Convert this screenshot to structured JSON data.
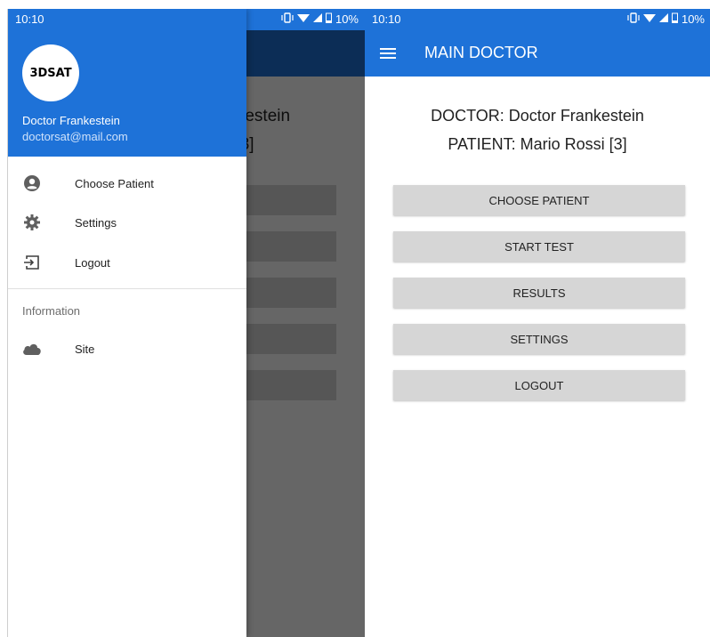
{
  "status_bar": {
    "time": "10:10",
    "battery": "10%"
  },
  "drawer": {
    "logo_text": "3DSAT",
    "user_name": "Doctor Frankestein",
    "user_email": "doctorsat@mail.com",
    "items": [
      {
        "label": "Choose Patient",
        "icon": "account-circle-icon"
      },
      {
        "label": "Settings",
        "icon": "gear-icon"
      },
      {
        "label": "Logout",
        "icon": "logout-icon"
      }
    ],
    "section_label": "Information",
    "section_items": [
      {
        "label": "Site",
        "icon": "cloud-icon"
      }
    ]
  },
  "main": {
    "title": "MAIN DOCTOR",
    "doctor_line": "DOCTOR: Doctor Frankestein",
    "patient_line": "PATIENT: Mario Rossi [3]",
    "buttons": [
      {
        "label": "CHOOSE PATIENT"
      },
      {
        "label": "START TEST"
      },
      {
        "label": "RESULTS"
      },
      {
        "label": "SETTINGS"
      },
      {
        "label": "LOGOUT"
      }
    ]
  },
  "colors": {
    "primary": "#1e72d8",
    "button_bg": "#d6d6d6"
  }
}
